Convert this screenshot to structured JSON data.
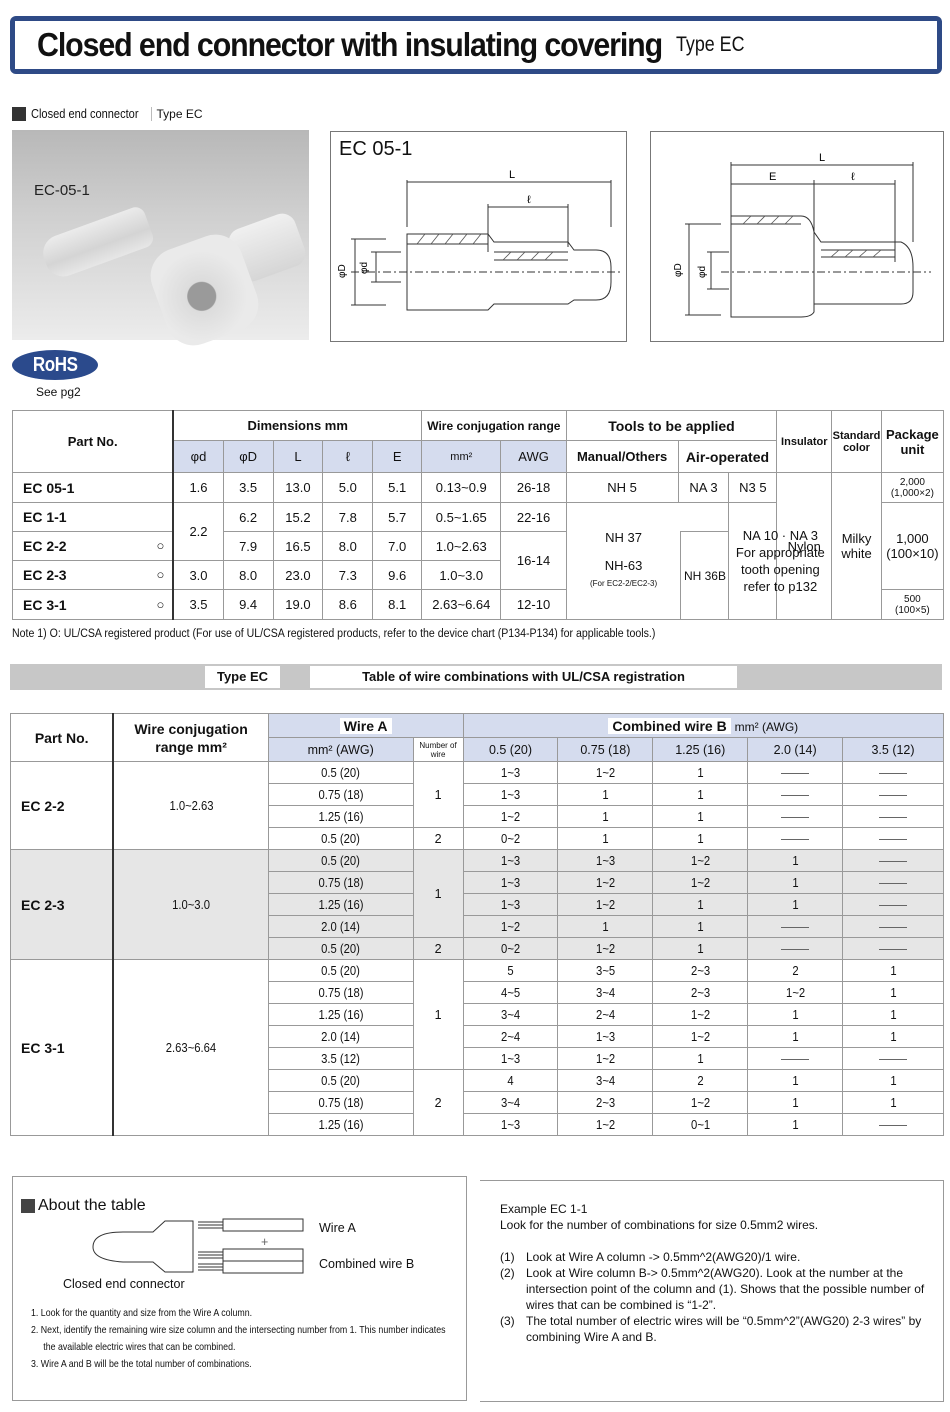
{
  "header": {
    "title": "Closed end connector with insulating covering",
    "subtitle": "Type EC"
  },
  "section": {
    "label": "Closed end connector",
    "type": "Type EC"
  },
  "photo": {
    "label": "EC-05-1"
  },
  "rohs": {
    "badge": "RoHS",
    "note": "See pg2"
  },
  "drawings": [
    {
      "label": "EC 05-1",
      "dims": {
        "L": "L",
        "l": "ℓ",
        "D": "φD",
        "d": "φd"
      }
    },
    {
      "label": "",
      "dims": {
        "L": "L",
        "E": "E",
        "l": "ℓ",
        "D": "φD",
        "d": "φd"
      }
    }
  ],
  "spec_table": {
    "headers": {
      "part_no": "Part No.",
      "dimensions": "Dimensions mm",
      "wire_range": "Wire conjugation range",
      "tools": "Tools to be applied",
      "insulator": "Insulator",
      "standard_color": "Standard color",
      "package_unit": "Package unit",
      "phi_d": "φd",
      "phi_D": "φD",
      "L": "L",
      "l": "ℓ",
      "E": "E",
      "mm2": "mm²",
      "awg": "AWG",
      "manual": "Manual/Others",
      "air": "Air-operated"
    },
    "rows": [
      {
        "part": "EC 05-1",
        "ul": "",
        "d": "1.6",
        "D": "3.5",
        "L": "13.0",
        "l": "5.0",
        "E": "5.1",
        "mm2": "0.13~0.9",
        "awg": "26-18"
      },
      {
        "part": "EC 1-1",
        "ul": "",
        "d": "2.2",
        "D": "6.2",
        "L": "15.2",
        "l": "7.8",
        "E": "5.7",
        "mm2": "0.5~1.65",
        "awg": "22-16"
      },
      {
        "part": "EC 2-2",
        "ul": "○",
        "d": "",
        "D": "7.9",
        "L": "16.5",
        "l": "8.0",
        "E": "7.0",
        "mm2": "1.0~2.63",
        "awg": "16-14"
      },
      {
        "part": "EC 2-3",
        "ul": "○",
        "d": "3.0",
        "D": "8.0",
        "L": "23.0",
        "l": "7.3",
        "E": "9.6",
        "mm2": "1.0~3.0",
        "awg": ""
      },
      {
        "part": "EC 3-1",
        "ul": "○",
        "d": "3.5",
        "D": "9.4",
        "L": "19.0",
        "l": "8.6",
        "E": "8.1",
        "mm2": "2.63~6.64",
        "awg": "12-10"
      }
    ],
    "tools": {
      "nh5": "NH 5",
      "na3": "NA 3",
      "n35": "N3 5",
      "nh37": "NH 37",
      "nh63": "NH-63",
      "nh63_note": "(For EC2-2/EC2-3)",
      "nh36b": "NH 36B",
      "air_group": "NA 10 · NA 3",
      "air_note": "For appropriate tooth opening refer to p132"
    },
    "insulator": "Nylon",
    "color": "Milky white",
    "packages": [
      {
        "qty": "2,000",
        "detail": "(1,000×2)"
      },
      {
        "qty": "1,000",
        "detail": "(100×10)"
      },
      {
        "qty": "500",
        "detail": "(100×5)"
      }
    ]
  },
  "note": "Note 1) O: UL/CSA registered product (For use of UL/CSA registered products, refer to the device chart (P134-P134) for applicable tools.)",
  "combo_banner": {
    "type": "Type EC",
    "title": "Table of wire combinations with UL/CSA registration"
  },
  "combo_table": {
    "headers": {
      "part_no": "Part No.",
      "range": "Wire conjugation range mm²",
      "wire_a": "Wire  A",
      "combined": "Combined wire  B",
      "combined_unit": "mm² (AWG)",
      "mm2_awg": "mm² (AWG)",
      "num_wire": "Number of wire",
      "b_cols": [
        "0.5 (20)",
        "0.75 (18)",
        "1.25 (16)",
        "2.0 (14)",
        "3.5 (12)"
      ]
    },
    "groups": [
      {
        "part": "EC 2-2",
        "range": "1.0~2.63",
        "rows": [
          {
            "a": "0.5 (20)",
            "n": "1",
            "b": [
              "1~3",
              "1~2",
              "1",
              "—",
              "—"
            ]
          },
          {
            "a": "0.75 (18)",
            "n": "",
            "b": [
              "1~3",
              "1",
              "1",
              "—",
              "—"
            ]
          },
          {
            "a": "1.25 (16)",
            "n": "",
            "b": [
              "1~2",
              "1",
              "1",
              "—",
              "—"
            ]
          },
          {
            "a": "0.5 (20)",
            "n": "2",
            "b": [
              "0~2",
              "1",
              "1",
              "—",
              "—"
            ]
          }
        ]
      },
      {
        "part": "EC 2-3",
        "range": "1.0~3.0",
        "rows": [
          {
            "a": "0.5 (20)",
            "n": "1",
            "b": [
              "1~3",
              "1~3",
              "1~2",
              "1",
              "—"
            ]
          },
          {
            "a": "0.75 (18)",
            "n": "",
            "b": [
              "1~3",
              "1~2",
              "1~2",
              "1",
              "—"
            ]
          },
          {
            "a": "1.25 (16)",
            "n": "",
            "b": [
              "1~3",
              "1~2",
              "1",
              "1",
              "—"
            ]
          },
          {
            "a": "2.0 (14)",
            "n": "",
            "b": [
              "1~2",
              "1",
              "1",
              "—",
              "—"
            ]
          },
          {
            "a": "0.5 (20)",
            "n": "2",
            "b": [
              "0~2",
              "1~2",
              "1",
              "—",
              "—"
            ]
          }
        ]
      },
      {
        "part": "EC 3-1",
        "range": "2.63~6.64",
        "rows": [
          {
            "a": "0.5 (20)",
            "n": "1",
            "b": [
              "5",
              "3~5",
              "2~3",
              "2",
              "1"
            ]
          },
          {
            "a": "0.75 (18)",
            "n": "",
            "b": [
              "4~5",
              "3~4",
              "2~3",
              "1~2",
              "1"
            ]
          },
          {
            "a": "1.25 (16)",
            "n": "",
            "b": [
              "3~4",
              "2~4",
              "1~2",
              "1",
              "1"
            ]
          },
          {
            "a": "2.0 (14)",
            "n": "",
            "b": [
              "2~4",
              "1~3",
              "1~2",
              "1",
              "1"
            ]
          },
          {
            "a": "3.5 (12)",
            "n": "",
            "b": [
              "1~3",
              "1~2",
              "1",
              "—",
              "—"
            ]
          },
          {
            "a": "0.5 (20)",
            "n": "2",
            "b": [
              "4",
              "3~4",
              "2",
              "1",
              "1"
            ]
          },
          {
            "a": "0.75 (18)",
            "n": "",
            "b": [
              "3~4",
              "2~3",
              "1~2",
              "1",
              "1"
            ]
          },
          {
            "a": "1.25 (16)",
            "n": "",
            "b": [
              "1~3",
              "1~2",
              "0~1",
              "1",
              "—"
            ]
          }
        ]
      }
    ]
  },
  "about": {
    "title": "About the table",
    "wire_a": "Wire A",
    "plus": "+",
    "combined_b": "Combined wire B",
    "connector": "Closed end connector",
    "steps": [
      "1.  Look for the quantity and size from the Wire A column.",
      "2.  Next, identify the remaining wire size column and the intersecting number from 1. This number indicates",
      "     the available electric wires that can be combined.",
      "3.  Wire A and B will be the total number of combinations."
    ]
  },
  "example": {
    "title": "Example EC 1-1",
    "intro": "Look for the number of combinations for size 0.5mm2 wires.",
    "items": [
      {
        "num": "(1)",
        "text": "Look at Wire A column -> 0.5mm^2(AWG20)/1 wire."
      },
      {
        "num": "(2)",
        "text": "Look at Wire column B-> 0.5mm^2(AWG20). Look at the number at the intersection point of the column and (1). Shows that the possible number of wires that can be combined is “1-2”."
      },
      {
        "num": "(3)",
        "text": "The total number of electric wires will be “0.5mm^2”(AWG20) 2-3 wires” by combining Wire A and B."
      }
    ]
  },
  "colors": {
    "banner": "#2e4a86",
    "header_blue": "#d5dcee",
    "grey_band": "#c7c7c7",
    "rohs": "#2b4a8c"
  }
}
